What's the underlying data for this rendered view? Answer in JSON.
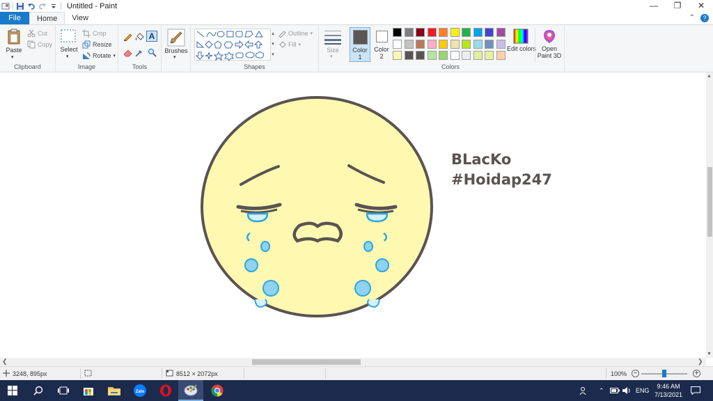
{
  "window": {
    "title": "Untitled - Paint",
    "controls": [
      "minimize",
      "maximize",
      "close"
    ]
  },
  "quick_access": [
    "paint-app-icon",
    "save-icon",
    "undo-icon",
    "redo-icon",
    "customize-icon"
  ],
  "tabs": [
    {
      "label": "File",
      "active": false
    },
    {
      "label": "Home",
      "active": true
    },
    {
      "label": "View",
      "active": false
    }
  ],
  "ribbon": {
    "clipboard": {
      "label": "Clipboard",
      "paste": "Paste",
      "cut": "Cut",
      "copy": "Copy"
    },
    "image": {
      "label": "Image",
      "select": "Select",
      "crop": "Crop",
      "resize": "Resize",
      "rotate": "Rotate"
    },
    "tools": {
      "label": "Tools",
      "items": [
        "pencil-icon",
        "fill-icon",
        "text-icon",
        "eraser-icon",
        "color-picker-icon",
        "magnifier-icon"
      ]
    },
    "brushes": {
      "label": "Brushes"
    },
    "shapes": {
      "label": "Shapes",
      "outline": "Outline",
      "fill": "Fill",
      "shape_icons": [
        "line",
        "curve",
        "oval",
        "rectangle",
        "rounded-rectangle",
        "polygon",
        "triangle",
        "right-triangle",
        "diamond",
        "pentagon",
        "hexagon",
        "right-arrow",
        "left-arrow",
        "up-arrow",
        "down-arrow",
        "four-point-star",
        "five-point-star",
        "six-point-star",
        "rounded-callout",
        "oval-callout",
        "cloud-callout",
        "heart",
        "lightning"
      ]
    },
    "size": {
      "label": "Size"
    },
    "color1": {
      "label": "Color",
      "num": "1",
      "color": "#5a5655"
    },
    "color2": {
      "label": "Color",
      "num": "2",
      "color": "#ffffff"
    },
    "colors": {
      "label": "Colors",
      "row1": [
        "#000000",
        "#7f7f7f",
        "#880015",
        "#ed1c24",
        "#ff7f27",
        "#fff200",
        "#22b14c",
        "#00a2e8",
        "#3f48cc",
        "#a349a4"
      ],
      "row2": [
        "#ffffff",
        "#c3c3c3",
        "#b97a57",
        "#ffaec9",
        "#ffc90e",
        "#efe4b0",
        "#b5e61d",
        "#99d9ea",
        "#7092be",
        "#c8bfe7"
      ],
      "row3": [
        "#fff7b0",
        "#595452",
        "#595452",
        "#b5e6a0",
        "#9bd56d",
        "#ffffff",
        "#ededf7",
        "#e0f0a0",
        "#e8f0a0",
        "#ffd0a8",
        "#f8c090",
        "#00b0f0"
      ]
    },
    "edit_colors": "Edit colors",
    "paint3d": "Open Paint 3D"
  },
  "canvas": {
    "text_line1": "BLacKo",
    "text_line2": "#Hoidap247"
  },
  "statusbar": {
    "position": "3248, 895px",
    "selection": "",
    "image_size": "8512 × 2072px",
    "zoom": "100%"
  },
  "taskbar": {
    "apps": [
      "windows-start-icon",
      "search-icon",
      "task-view-icon",
      "store-icon",
      "file-explorer-icon",
      "zalo-icon",
      "opera-icon",
      "paint-icon",
      "chrome-icon"
    ],
    "language": "ENG",
    "time": "9:46 AM",
    "date": "7/13/2021"
  }
}
